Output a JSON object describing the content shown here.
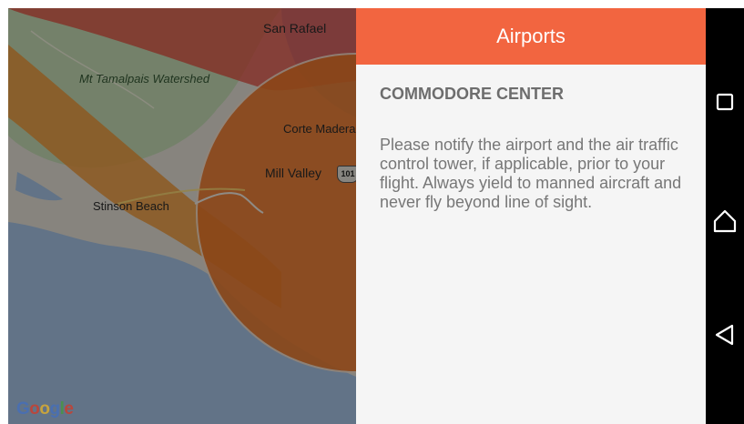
{
  "map": {
    "labels": {
      "san_rafael": "San Rafael",
      "mt_tamalpais": "Mt Tamalpais Watershed",
      "corte_madera": "Corte Madera",
      "mill_valley": "Mill Valley",
      "stinson_beach": "Stinson Beach",
      "highway": "101"
    },
    "attribution": [
      "G",
      "o",
      "o",
      "g",
      "l",
      "e"
    ],
    "colors": {
      "land": "#e8e4da",
      "park": "#c9dfb7",
      "water": "#a9c6e8",
      "restricted_zone": "#f29a3a",
      "restricted_zone_red": "#e6473a"
    }
  },
  "panel": {
    "title": "Airports",
    "airport_name": "COMMODORE CENTER",
    "notice": "Please notify the airport and the air traffic control tower, if applicable, prior to your flight. Always yield to manned aircraft and never fly beyond line of sight.",
    "accent_color": "#f26540"
  },
  "navbar": {
    "buttons": [
      "recents-icon",
      "home-icon",
      "back-icon"
    ]
  }
}
